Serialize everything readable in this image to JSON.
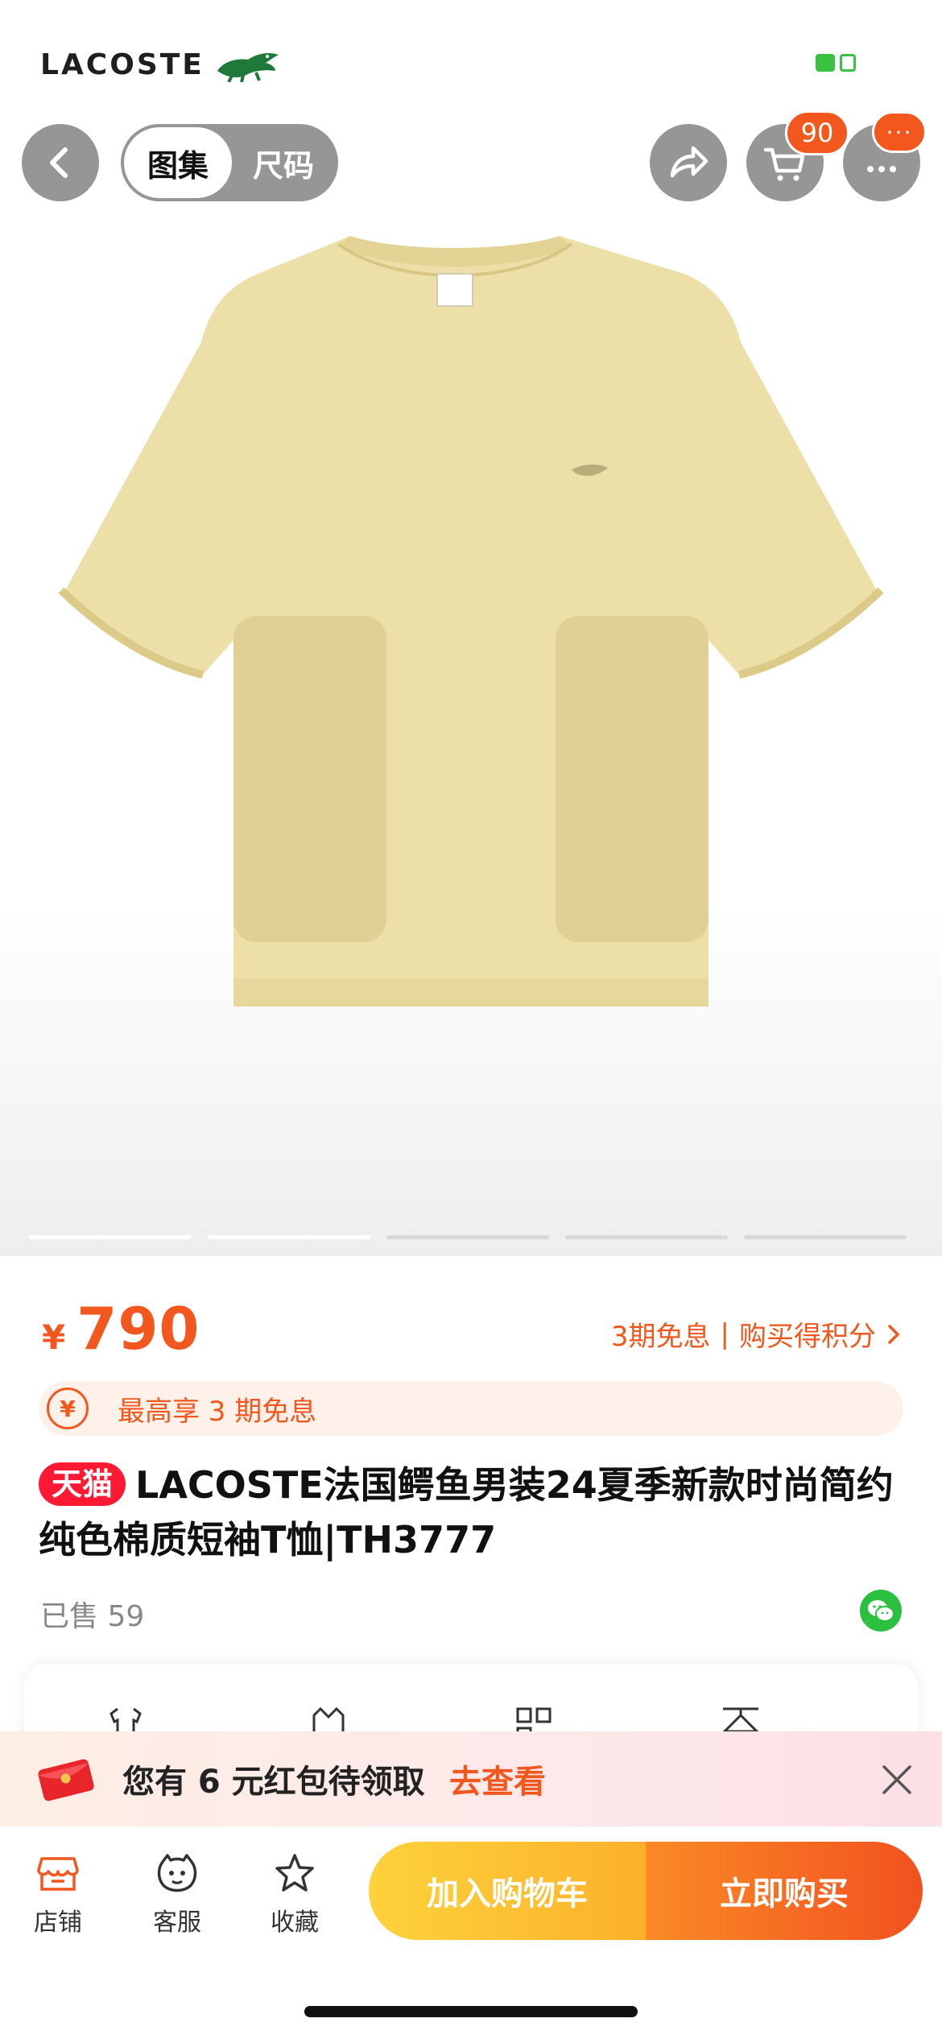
{
  "brand": {
    "name": "LACOSTE"
  },
  "header": {
    "segments": [
      {
        "label": "图集",
        "active": true
      },
      {
        "label": "尺码",
        "active": false
      }
    ],
    "cart_count": "90",
    "more_badge": "···"
  },
  "gallery": {
    "page_count": 5,
    "current_page": 2
  },
  "product": {
    "currency": "¥",
    "price": "790",
    "installment_link": "3期免息",
    "points_link": "购买得积分",
    "promo_text": "最高享 3 期免息",
    "platform_tag": "天猫",
    "title": "LACOSTE法国鳄鱼男装24夏季新款时尚简约纯色棉质短袖T恤|TH3777",
    "sold_label": "已售",
    "sold_count": "59"
  },
  "red_packet": {
    "text": "您有 6 元红包待领取",
    "link": "去查看"
  },
  "bottom_bar": {
    "tabs": [
      {
        "label": "店铺"
      },
      {
        "label": "客服"
      },
      {
        "label": "收藏"
      }
    ],
    "add_to_cart": "加入购物车",
    "buy_now": "立即购买"
  },
  "colors": {
    "accent": "#f2571d",
    "tmall": "#ff1a34",
    "cart_gradient": "#fdd23c",
    "buy_gradient": "#f2511f",
    "product": "#ecdfa8"
  }
}
